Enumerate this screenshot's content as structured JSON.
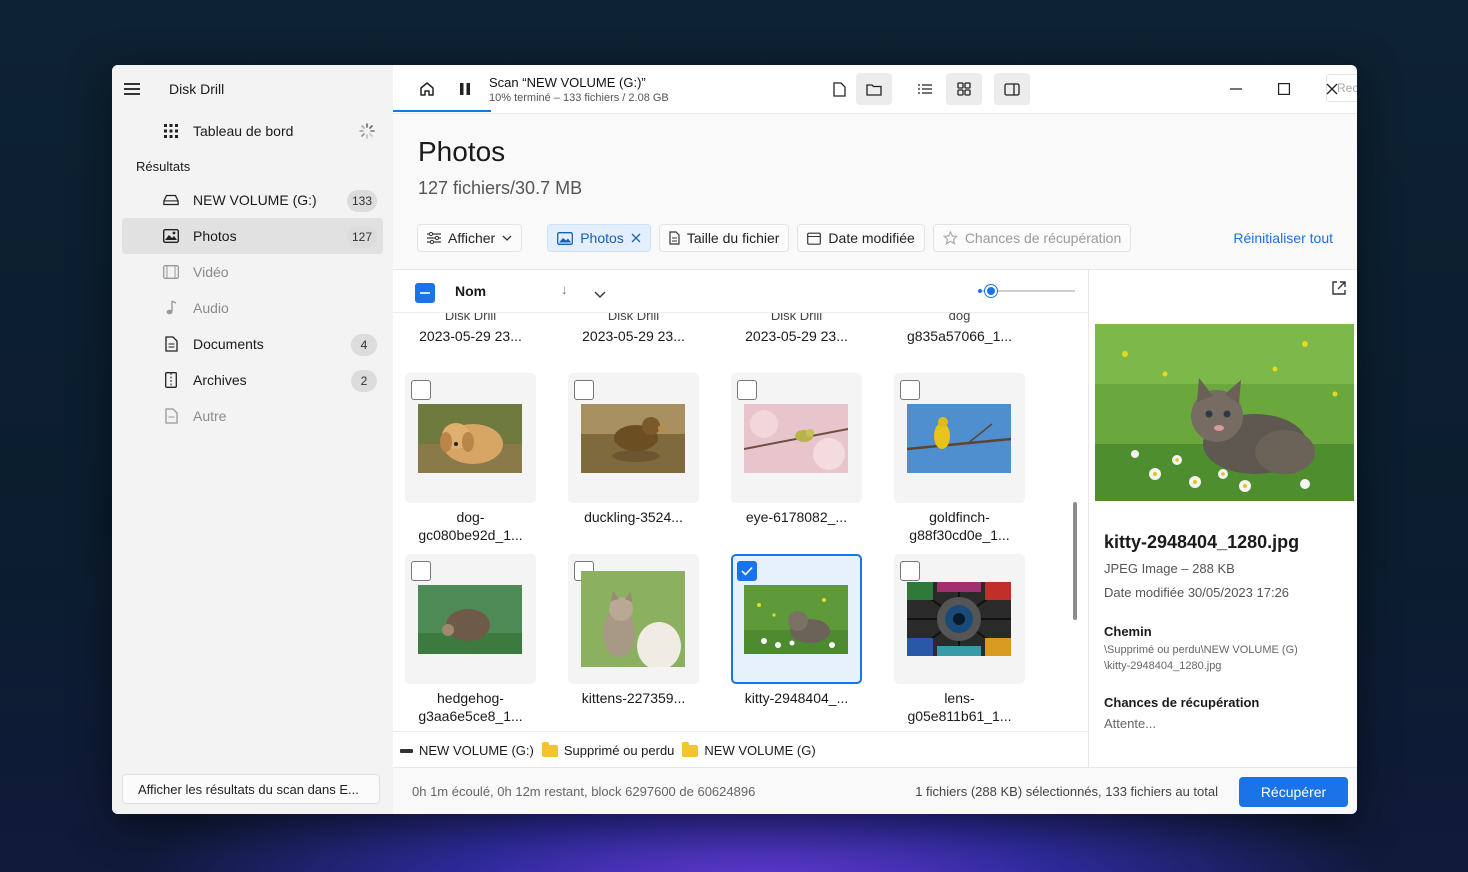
{
  "app": {
    "title": "Disk Drill"
  },
  "sidebar": {
    "dashboard_label": "Tableau de bord",
    "section_label": "Résultats",
    "items": [
      {
        "label": "NEW VOLUME (G:)",
        "count": "133",
        "icon": "drive-icon"
      },
      {
        "label": "Photos",
        "count": "127",
        "icon": "image-icon"
      },
      {
        "label": "Vidéo",
        "count": "",
        "icon": "film-icon"
      },
      {
        "label": "Audio",
        "count": "",
        "icon": "music-note-icon"
      },
      {
        "label": "Documents",
        "count": "4",
        "icon": "document-icon"
      },
      {
        "label": "Archives",
        "count": "2",
        "icon": "archive-icon"
      },
      {
        "label": "Autre",
        "count": "",
        "icon": "file-icon"
      }
    ],
    "bottom_button": "Afficher les résultats du scan dans E..."
  },
  "topbar": {
    "scan_title": "Scan “NEW VOLUME (G:)”",
    "scan_progress": "10% terminé – 133 fichiers / 2.08 GB",
    "search_placeholder": "Rechercher"
  },
  "main": {
    "title": "Photos",
    "subtitle": "127 fichiers/30.7 MB",
    "filters": {
      "view": "Afficher",
      "photos": "Photos",
      "size": "Taille du fichier",
      "date": "Date modifiée",
      "chances": "Chances de récupération"
    },
    "reset": "Réinitialiser tout",
    "column": "Nom"
  },
  "grid": {
    "cut_row": [
      {
        "top": "Disk Drill",
        "bottom": "2023-05-29 23..."
      },
      {
        "top": "Disk Drill",
        "bottom": "2023-05-29 23..."
      },
      {
        "top": "Disk Drill",
        "bottom": "2023-05-29 23..."
      },
      {
        "top": "dog",
        "bottom": "g835a57066_1..."
      }
    ],
    "tiles": [
      {
        "line1": "dog-",
        "line2": "gc080be92d_1...",
        "checked": false
      },
      {
        "line1": "duckling-3524...",
        "line2": "",
        "checked": false
      },
      {
        "line1": "eye-6178082_...",
        "line2": "",
        "checked": false
      },
      {
        "line1": "goldfinch-",
        "line2": "g88f30cd0e_1...",
        "checked": false
      },
      {
        "line1": "hedgehog-",
        "line2": "g3aa6e5ce8_1...",
        "checked": false
      },
      {
        "line1": "kittens-227359...",
        "line2": "",
        "checked": false
      },
      {
        "line1": "kitty-2948404_...",
        "line2": "",
        "checked": true
      },
      {
        "line1": "lens-",
        "line2": "g05e811b61_1...",
        "checked": false
      }
    ]
  },
  "breadcrumb": {
    "drive": "NEW VOLUME (G:)",
    "folder1": "Supprimé ou perdu",
    "folder2": "NEW VOLUME (G)"
  },
  "preview": {
    "filename": "kitty-2948404_1280.jpg",
    "type": "JPEG Image – 288 KB",
    "date": "Date modifiée 30/05/2023 17:26",
    "path_label": "Chemin",
    "path_line1": "\\Supprimé ou perdu\\NEW VOLUME (G)",
    "path_line2": "\\kitty-2948404_1280.jpg",
    "chances_label": "Chances de récupération",
    "chances_value": "Attente..."
  },
  "status": {
    "elapsed": "0h 1m écoulé, 0h 12m restant, block 6297600 de 60624896",
    "selection": "1 fichiers (288 KB) sélectionnés, 133 fichiers au total",
    "recover": "Récupérer"
  },
  "colors": {
    "accent": "#1a73e8"
  }
}
